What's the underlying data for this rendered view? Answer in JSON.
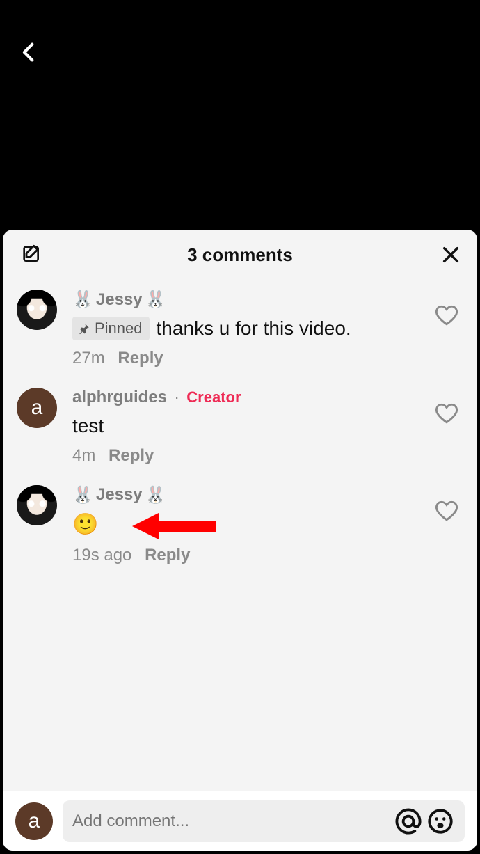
{
  "sheet": {
    "title": "3 comments"
  },
  "labels": {
    "pinned": "Pinned",
    "reply": "Reply",
    "creator": "Creator"
  },
  "input": {
    "placeholder": "Add comment..."
  },
  "me": {
    "avatar_letter": "a"
  },
  "comments": [
    {
      "username_prefix": "🐰",
      "username": "Jessy",
      "username_suffix": "🐰",
      "pinned": true,
      "text": "thanks u for this video.",
      "time": "27m"
    },
    {
      "avatar_letter": "a",
      "username": "alphrguides",
      "is_creator": true,
      "text": "test",
      "time": "4m"
    },
    {
      "username_prefix": "🐰",
      "username": "Jessy",
      "username_suffix": "🐰",
      "text": "🙂",
      "time": "19s ago"
    }
  ]
}
